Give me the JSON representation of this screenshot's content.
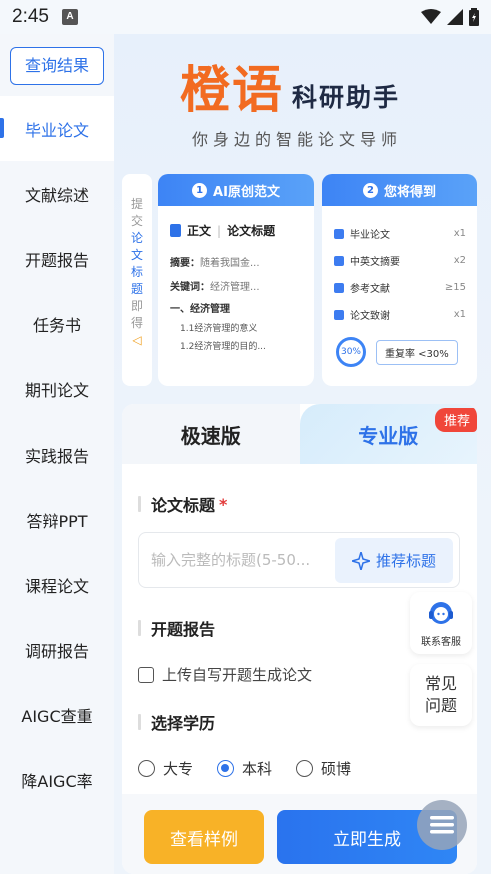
{
  "status_bar": {
    "time": "2:45",
    "notification_glyph": "A"
  },
  "sidebar": {
    "query_button": "查询结果",
    "items": [
      {
        "label": "毕业论文",
        "active": true
      },
      {
        "label": "文献综述",
        "active": false
      },
      {
        "label": "开题报告",
        "active": false
      },
      {
        "label": "任务书",
        "active": false
      },
      {
        "label": "期刊论文",
        "active": false
      },
      {
        "label": "实践报告",
        "active": false
      },
      {
        "label": "答辩PPT",
        "active": false
      },
      {
        "label": "课程论文",
        "active": false
      },
      {
        "label": "调研报告",
        "active": false
      },
      {
        "label": "AIGC查重",
        "active": false
      },
      {
        "label": "降AIGC率",
        "active": false
      }
    ]
  },
  "brand": {
    "name": "橙语",
    "subtitle": "科研助手",
    "tagline": "你身边的智能论文导师"
  },
  "steps": {
    "chars": [
      "提",
      "交",
      "论",
      "文",
      "标",
      "题",
      "即",
      "得"
    ],
    "arrow": "✓"
  },
  "card1": {
    "number": "1",
    "title": "AI原创范文",
    "doc_label": "正文",
    "doc_title": "论文标题",
    "abstract_label": "摘要：",
    "abstract_text": "随着我国金...",
    "keywords_label": "关键词：",
    "keywords_text": "经济管理...",
    "section": "一、经济管理",
    "sub1": "1.1经济管理的意义",
    "sub2": "1.2经济管理的目的..."
  },
  "card2": {
    "number": "2",
    "title": "您将得到",
    "items": [
      {
        "label": "毕业论文",
        "value": "x1",
        "icon": "graduation-icon"
      },
      {
        "label": "中英文摘要",
        "value": "x2",
        "icon": "document-icon"
      },
      {
        "label": "参考文献",
        "value": "≥15",
        "icon": "books-icon"
      },
      {
        "label": "论文致谢",
        "value": "x1",
        "icon": "mail-icon"
      }
    ],
    "percent": "30%",
    "rate_text": "重复率 <30%"
  },
  "tabs": {
    "fast": "极速版",
    "pro": "专业版",
    "badge": "推荐"
  },
  "form": {
    "title_label": "论文标题",
    "required_mark": "*",
    "title_placeholder": "输入完整的标题(5-50...",
    "recommend_button": "推荐标题",
    "proposal_label": "开题报告",
    "upload_checkbox": "上传自写开题生成论文",
    "degree_label": "选择学历",
    "degrees": [
      {
        "label": "大专",
        "checked": false
      },
      {
        "label": "本科",
        "checked": true
      },
      {
        "label": "硕博",
        "checked": false
      }
    ]
  },
  "actions": {
    "sample": "查看样例",
    "generate": "立即生成"
  },
  "floating": {
    "service": "联系客服",
    "faq_line1": "常见",
    "faq_line2": "问题"
  },
  "colors": {
    "accent": "#2e72e8",
    "brand": "#f26b21",
    "sample_button": "#f8b227",
    "badge": "#f0463a"
  }
}
